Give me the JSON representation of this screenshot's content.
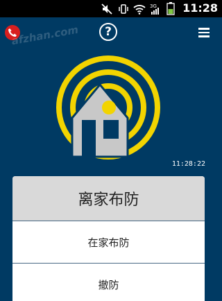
{
  "status_bar": {
    "time": "11:28",
    "icons": [
      "mute-icon",
      "vibrate-icon",
      "wifi-icon",
      "3g-signal-icon",
      "signal-icon",
      "battery-icon"
    ]
  },
  "app_bar": {
    "help_glyph": "?",
    "icons": [
      "phone-icon",
      "help-icon",
      "menu-icon"
    ]
  },
  "watermark": "afzhan.com",
  "hero": {
    "icon": "house-alarm-icon",
    "colors": {
      "rings": "#f2d400",
      "house": "#c8c8c8",
      "background": "#003a63"
    }
  },
  "timestamp": "11:28:22",
  "panel": {
    "title": "离家布防",
    "options": [
      "在家布防",
      "撤防"
    ]
  }
}
